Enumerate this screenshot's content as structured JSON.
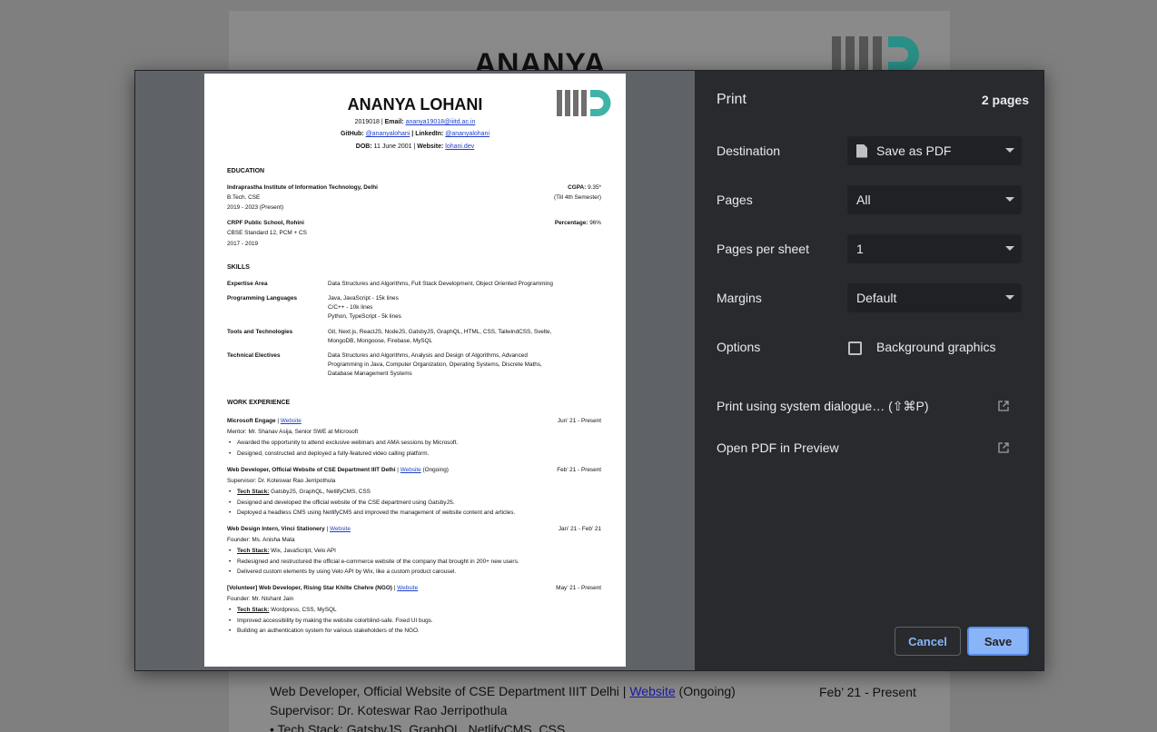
{
  "background_page": {
    "name": "ANANYA LOHANI",
    "line1_title": "Web Developer, Official Website of CSE Department IIIT Delhi",
    "line1_sep": " | ",
    "line1_link": "Website",
    "line1_suffix": " (Ongoing)",
    "line1_date": "Feb’ 21 - Present",
    "line2": "Supervisor: Dr. Koteswar Rao Jerripothula",
    "line3": "• Tech Stack: GatsbyJS, GraphQL, NetlifyCMS, CSS"
  },
  "preview": {
    "name": "ANANYA LOHANI",
    "contact1_prefix": "2019018 | ",
    "contact1_label": "Email: ",
    "contact1_link": "ananya19018@iiitd.ac.in",
    "contact2_label_a": "GitHub: ",
    "contact2_link_a": "@ananyalohani",
    "contact2_label_b": " | LinkedIn: ",
    "contact2_link_b": "@ananyalohani",
    "contact3_label_a": "DOB: ",
    "contact3_value": "11 June 2001 | ",
    "contact3_label_b": "Website: ",
    "contact3_link": "lohani.dev",
    "education_heading": "EDUCATION",
    "edu1_school": "Indraprastha Institute of Information Technology, Delhi",
    "edu1_degree": "B.Tech. CSE",
    "edu1_years": "2019 - 2023 (Present)",
    "edu1_score_label": "CGPA: ",
    "edu1_score": "9.35*",
    "edu1_note": "(Till 4th Semester)",
    "edu2_school": "CRPF Public School, Rohini",
    "edu2_degree": "CBSE Standard 12, PCM + CS",
    "edu2_years": "2017 - 2019",
    "edu2_score_label": "Percentage: ",
    "edu2_score": "96%",
    "skills_heading": "SKILLS",
    "skills": [
      {
        "label": "Expertise Area",
        "lines": [
          "Data Structures and Algorithms, Full Stack Development, Object Oriented Programming"
        ]
      },
      {
        "label": "Programming Languages",
        "lines": [
          "Java, JavaScript - 15k lines",
          "C/C++ - 10k lines",
          "Python, TypeScript - 5k lines"
        ]
      },
      {
        "label": "Tools and Technologies",
        "lines": [
          "Git, Next.js, ReactJS, NodeJS, GatsbyJS, GraphQL, HTML, CSS, TailwindCSS, Svelte,",
          "MongoDB, Mongoose, Firebase, MySQL"
        ]
      },
      {
        "label": "Technical Electives",
        "lines": [
          "Data Structures and Algorithms, Analysis and Design of Algorithms, Advanced",
          "Programming in Java, Computer Organization, Operating Systems, Discrete Maths,",
          "Database Management Systems"
        ]
      }
    ],
    "work_heading": "WORK EXPERIENCE",
    "jobs": [
      {
        "title": "Microsoft Engage",
        "link": "Website",
        "suffix": "",
        "date": "Jun’ 21 - Present",
        "sub": "Mentor: Mr. Shanav Asija, Senior SWE at Microsoft",
        "bullets": [
          {
            "bold": "",
            "text": "Awarded the opportunity to attend exclusive webinars and AMA sessions by Microsoft."
          },
          {
            "bold": "",
            "text": "Designed, constructed and deployed a fully-featured video calling platform."
          }
        ]
      },
      {
        "title": "Web Developer, Official Website of CSE Department IIIT Delhi",
        "link": "Website",
        "suffix": " (Ongoing)",
        "date": "Feb’ 21 - Present",
        "sub": "Supervisor: Dr. Koteswar Rao Jerripothula",
        "bullets": [
          {
            "bold": "Tech Stack:",
            "text": " GatsbyJS, GraphQL, NetlifyCMS, CSS"
          },
          {
            "bold": "",
            "text": "Designed and developed the official website of the CSE department using GatsbyJS."
          },
          {
            "bold": "",
            "text": "Deployed a headless CMS using NetlifyCMS and improved the management of website content and articles."
          }
        ]
      },
      {
        "title": "Web Design Intern, Vinci Stationery",
        "link": "Website",
        "suffix": "",
        "date": "Jan’ 21 - Feb’ 21",
        "sub": "Founder: Ms. Anisha Mata",
        "bullets": [
          {
            "bold": "Tech Stack:",
            "text": " Wix, JavaScript, Velo API"
          },
          {
            "bold": "",
            "text": "Redesigned and restructured the official e-commerce website of the company that brought in 200+ new users."
          },
          {
            "bold": "",
            "text": "Delivered custom elements by using Velo API by Wix, like a custom product carousel."
          }
        ]
      },
      {
        "title": "[Volunteer] Web Developer, Rising Star Khilte Chehre (NGO)",
        "link": "Website",
        "suffix": "",
        "date": "May’ 21 - Present",
        "sub": "Founder: Mr. Nishant Jain",
        "bullets": [
          {
            "bold": "Tech Stack:",
            "text": " Wordpress, CSS, MySQL"
          },
          {
            "bold": "",
            "text": "Improved accessibility by making the website colorblind-safe. Fixed UI bugs."
          },
          {
            "bold": "",
            "text": "Building an authentication system for various stakeholders of the NGO."
          }
        ]
      }
    ]
  },
  "print": {
    "title": "Print",
    "page_count": "2 pages",
    "destination_label": "Destination",
    "destination_value": "Save as PDF",
    "pages_label": "Pages",
    "pages_value": "All",
    "pps_label": "Pages per sheet",
    "pps_value": "1",
    "margins_label": "Margins",
    "margins_value": "Default",
    "options_label": "Options",
    "background_graphics_label": "Background graphics",
    "background_graphics_checked": false,
    "system_dialog_label": "Print using system dialogue… (⇧⌘P)",
    "open_pdf_label": "Open PDF in Preview",
    "cancel_label": "Cancel",
    "save_label": "Save"
  },
  "colors": {
    "panel_bg": "#292a2d",
    "select_bg": "#202124",
    "accent": "#8ab4f8",
    "logo_gray": "#6f6f6f",
    "logo_teal": "#3fb3a7"
  }
}
